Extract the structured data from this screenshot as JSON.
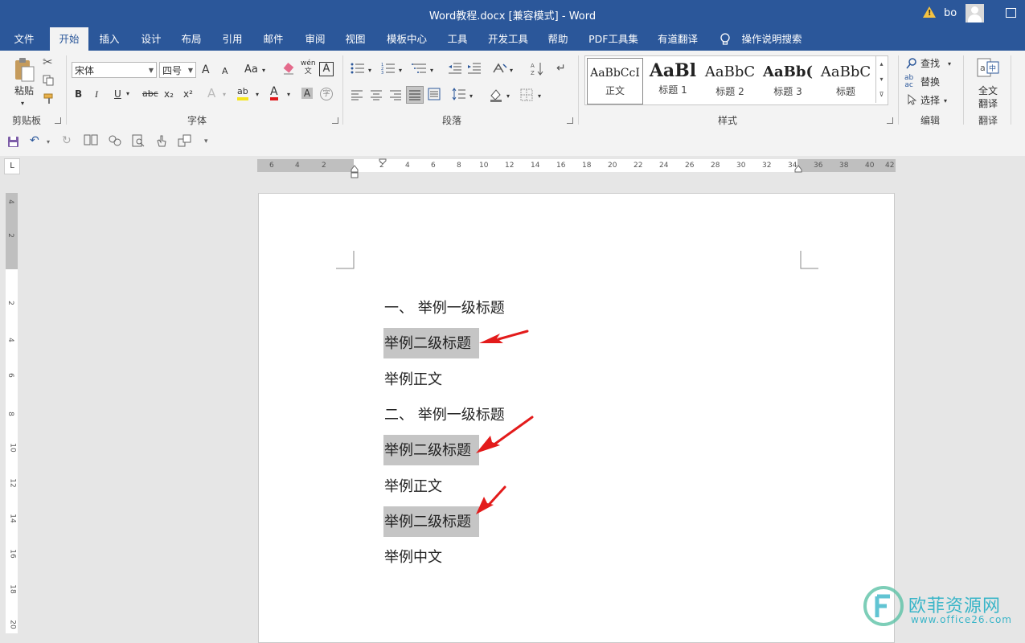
{
  "window": {
    "title": "Word教程.docx [兼容模式]  -  Word",
    "user": "bo",
    "warning_glyph": "!"
  },
  "tabs": [
    {
      "label": "文件"
    },
    {
      "label": "开始"
    },
    {
      "label": "插入"
    },
    {
      "label": "设计"
    },
    {
      "label": "布局"
    },
    {
      "label": "引用"
    },
    {
      "label": "邮件"
    },
    {
      "label": "审阅"
    },
    {
      "label": "视图"
    },
    {
      "label": "模板中心"
    },
    {
      "label": "工具"
    },
    {
      "label": "开发工具"
    },
    {
      "label": "帮助"
    },
    {
      "label": "PDF工具集"
    },
    {
      "label": "有道翻译"
    },
    {
      "label": "操作说明搜索"
    }
  ],
  "ribbon": {
    "clipboard": {
      "label": "剪贴板",
      "paste": "粘贴"
    },
    "font": {
      "label": "字体",
      "font_name": "宋体",
      "font_size": "四号",
      "bold": "B",
      "italic": "I",
      "underline": "U",
      "strike": "abc",
      "subscript": "x₂",
      "superscript": "x²",
      "change_case": "Aa",
      "grow": "A",
      "shrink": "A",
      "phonetic": "wén",
      "phonetic_sub": "文",
      "font_color": "A",
      "highlight": "ab",
      "char_shading": "A",
      "enclose": "字"
    },
    "paragraph": {
      "label": "段落"
    },
    "styles": {
      "label": "样式",
      "items": [
        {
          "sample": "AaBbCcI",
          "name": "正文"
        },
        {
          "sample": "AaBl",
          "name": "标题 1"
        },
        {
          "sample": "AaBbC",
          "name": "标题 2"
        },
        {
          "sample": "AaBb(",
          "name": "标题 3"
        },
        {
          "sample": "AaBbC",
          "name": "标题"
        }
      ]
    },
    "editing": {
      "label": "编辑",
      "find": "查找",
      "replace": "替换",
      "select": "选择"
    },
    "translate": {
      "label": "翻译",
      "full_text": "全文",
      "full_text2": "翻译"
    }
  },
  "ruler": {
    "h_ticks": [
      "6",
      "4",
      "2",
      "2",
      "4",
      "6",
      "8",
      "10",
      "12",
      "14",
      "16",
      "18",
      "20",
      "22",
      "24",
      "26",
      "28",
      "30",
      "32",
      "34",
      "36",
      "38",
      "40",
      "42"
    ],
    "v_ticks": [
      "4",
      "2",
      "2",
      "4",
      "6",
      "8",
      "10",
      "12",
      "14",
      "16",
      "18",
      "20"
    ]
  },
  "document": {
    "lines": [
      {
        "text": "一、  举例一级标题",
        "highlight": false
      },
      {
        "text": "举例二级标题",
        "highlight": true
      },
      {
        "text": "举例正文",
        "highlight": false
      },
      {
        "text": "二、  举例一级标题",
        "highlight": false
      },
      {
        "text": "举例二级标题",
        "highlight": true
      },
      {
        "text": "举例正文",
        "highlight": false
      },
      {
        "text": "举例二级标题",
        "highlight": true
      },
      {
        "text": "举例中文",
        "highlight": false
      }
    ]
  },
  "watermark": {
    "name": "欧菲资源网",
    "url": "www.office26.com"
  },
  "colors": {
    "accent": "#2b579a",
    "arrow": "#e31b1b",
    "highlight": "#c5c5c5"
  }
}
